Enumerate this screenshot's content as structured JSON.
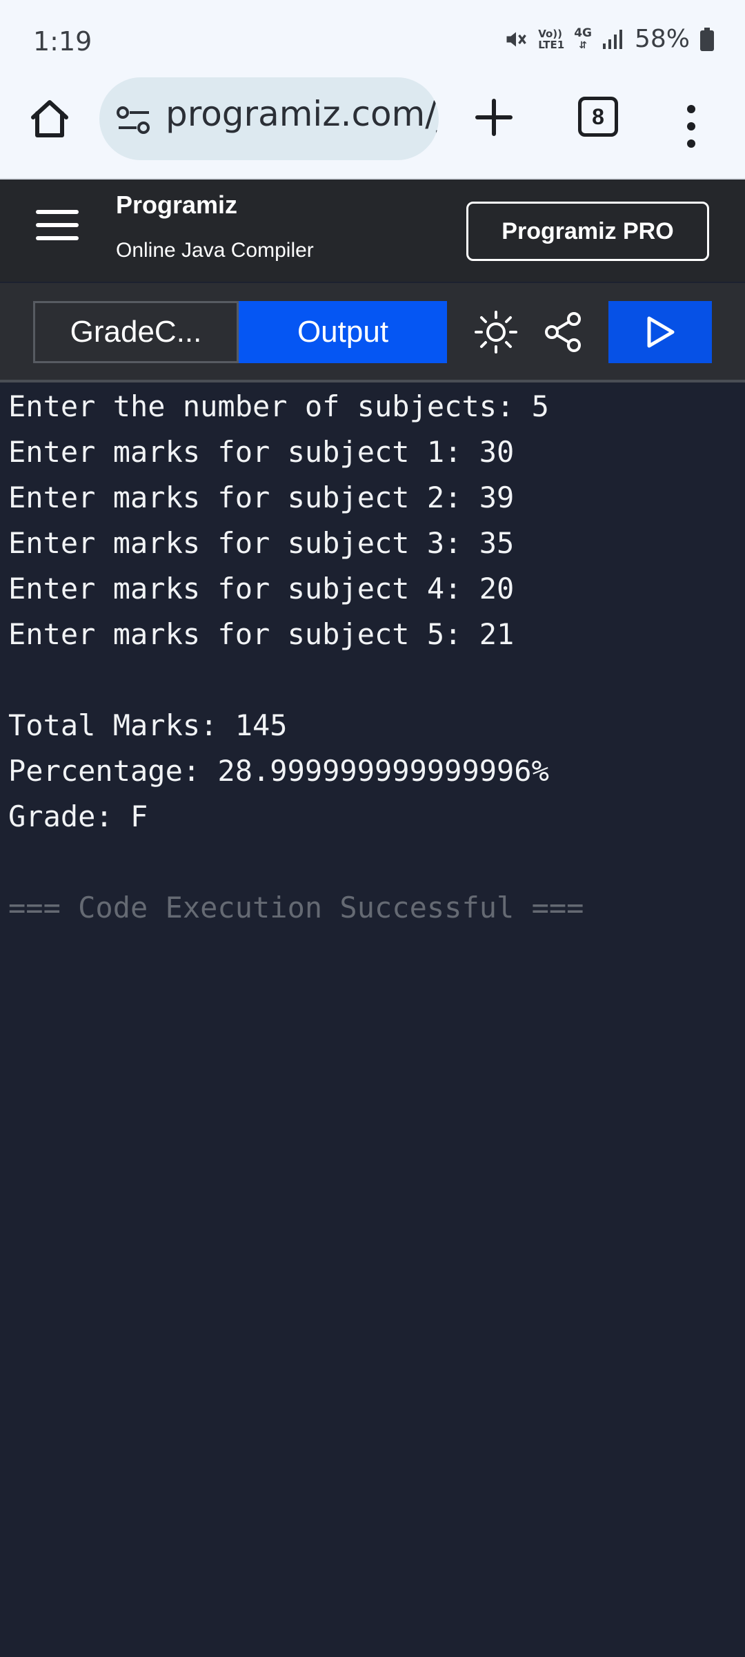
{
  "status_bar": {
    "time": "1:19",
    "net_label_1": "Vo))",
    "net_label_2": "LTE1",
    "net_label_3": "4G",
    "battery": "58%"
  },
  "browser": {
    "url": "programiz.com/ja",
    "tab_count": "8"
  },
  "site": {
    "brand": "Programiz",
    "subtitle": "Online Java Compiler",
    "pro_button": "Programiz PRO"
  },
  "toolbar": {
    "file_tab": "GradeC...",
    "output_tab": "Output"
  },
  "console": {
    "lines": [
      "Enter the number of subjects: 5",
      "Enter marks for subject 1: 30",
      "Enter marks for subject 2: 39",
      "Enter marks for subject 3: 35",
      "Enter marks for subject 4: 20",
      "Enter marks for subject 5: 21",
      "",
      "Total Marks: 145",
      "Percentage: 28.999999999999996%",
      "Grade: F",
      "",
      "=== Code Execution Successful ==="
    ]
  },
  "colors": {
    "output_tab": "#0556f3",
    "run_button": "#0651e6",
    "console_bg": "#1c2130",
    "header_bg": "#25272b"
  }
}
